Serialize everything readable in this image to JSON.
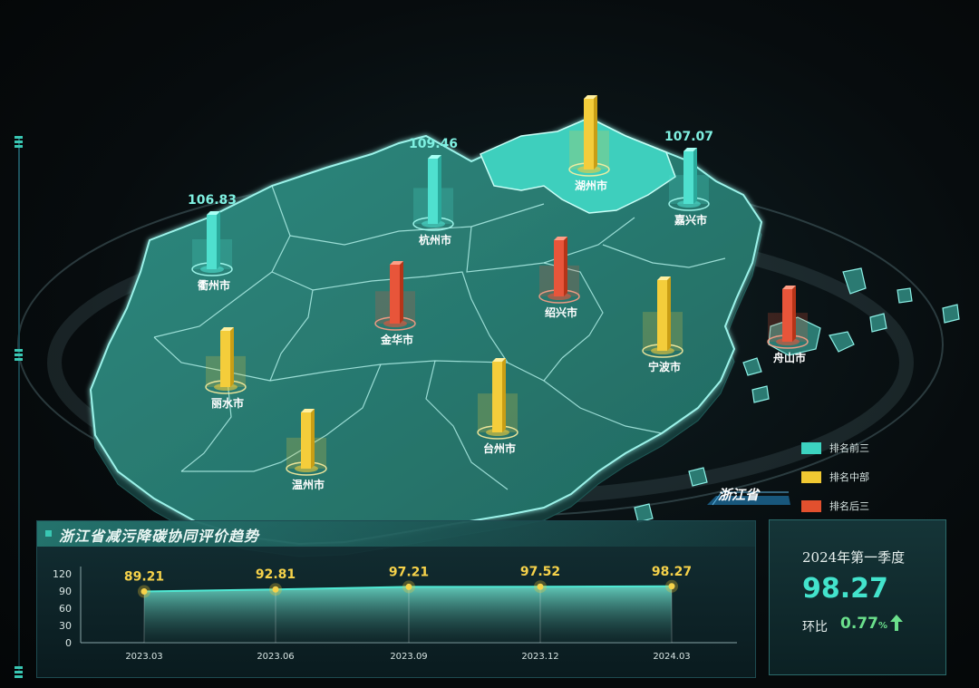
{
  "map": {
    "province_label": "浙江省",
    "cities": [
      {
        "name": "湖州市",
        "rank_group": "middle",
        "value_label": ""
      },
      {
        "name": "杭州市",
        "rank_group": "top",
        "value_label": "109.46"
      },
      {
        "name": "嘉兴市",
        "rank_group": "top",
        "value_label": "107.07"
      },
      {
        "name": "衢州市",
        "rank_group": "top",
        "value_label": "106.83"
      },
      {
        "name": "金华市",
        "rank_group": "bottom",
        "value_label": ""
      },
      {
        "name": "绍兴市",
        "rank_group": "bottom",
        "value_label": ""
      },
      {
        "name": "宁波市",
        "rank_group": "middle",
        "value_label": ""
      },
      {
        "name": "舟山市",
        "rank_group": "bottom",
        "value_label": ""
      },
      {
        "name": "丽水市",
        "rank_group": "middle",
        "value_label": ""
      },
      {
        "name": "台州市",
        "rank_group": "middle",
        "value_label": ""
      },
      {
        "name": "温州市",
        "rank_group": "middle",
        "value_label": ""
      }
    ]
  },
  "legend": {
    "items": [
      {
        "key": "top",
        "label": "排名前三",
        "color": "#3cd3c0"
      },
      {
        "key": "middle",
        "label": "排名中部",
        "color": "#f0c832"
      },
      {
        "key": "bottom",
        "label": "排名后三",
        "color": "#e2502e"
      }
    ]
  },
  "trend": {
    "title": "浙江省减污降碳协同评价趋势",
    "chart_data": {
      "type": "area",
      "categories": [
        "2023.03",
        "2023.06",
        "2023.09",
        "2023.12",
        "2024.03"
      ],
      "values": [
        89.21,
        92.81,
        97.21,
        97.52,
        98.27
      ],
      "ylim": [
        0,
        120
      ],
      "yticks": [
        0,
        30,
        60,
        90,
        120
      ],
      "data_labels": [
        "89.21",
        "92.81",
        "97.21",
        "97.52",
        "98.27"
      ]
    }
  },
  "stat": {
    "period": "2024年第一季度",
    "value": "98.27",
    "change_label": "环比",
    "change_value": "0.77",
    "change_unit": "%",
    "direction": "up"
  },
  "colors": {
    "top": "#3cd3c0",
    "middle": "#f0c832",
    "bottom": "#e2502e",
    "land": "#2b7a72",
    "land_edge": "#9cf3ea"
  }
}
